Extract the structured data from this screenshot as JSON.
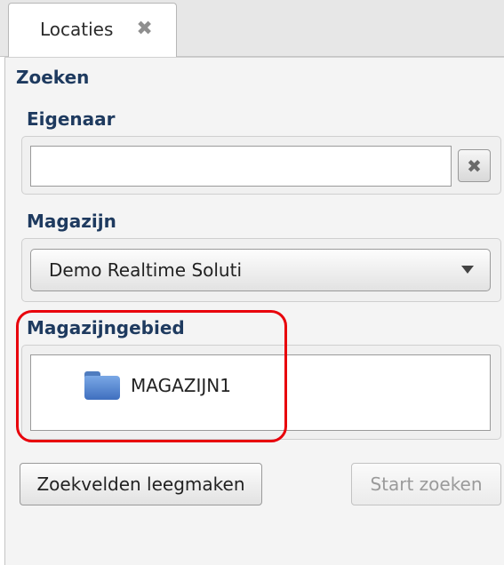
{
  "tabs": [
    {
      "label": "Locaties",
      "close_icon": "close-icon"
    }
  ],
  "panel": {
    "title": "Zoeken",
    "owner": {
      "label": "Eigenaar",
      "value": "",
      "placeholder": ""
    },
    "warehouse": {
      "label": "Magazijn",
      "selected": "Demo Realtime Soluti"
    },
    "area": {
      "label": "Magazijngebied",
      "items": [
        {
          "label": "MAGAZIJN1",
          "icon": "folder-icon"
        }
      ]
    },
    "buttons": {
      "clear_label": "Zoekvelden leegmaken",
      "search_label": "Start zoeken"
    }
  },
  "colors": {
    "heading": "#1e3a5f",
    "highlight": "#e8000b",
    "disabled_text": "#9a9a9a"
  }
}
